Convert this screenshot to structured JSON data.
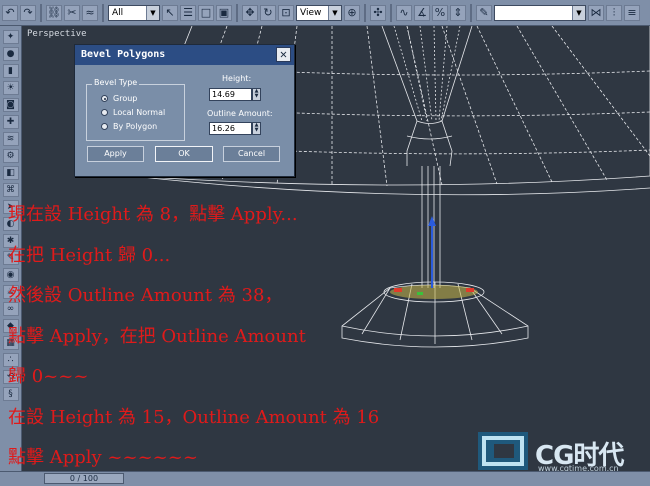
{
  "toolbar": {
    "selection_filter": "All",
    "reference_coord": "View",
    "named_selection": ""
  },
  "viewport": {
    "label": "Perspective"
  },
  "dialog": {
    "title": "Bevel Polygons",
    "close_glyph": "✕",
    "bevel_type": {
      "title": "Bevel Type",
      "options": [
        "Group",
        "Local Normal",
        "By Polygon"
      ],
      "selected": "Group"
    },
    "height": {
      "label": "Height:",
      "value": "14.69"
    },
    "outline_amount": {
      "label": "Outline Amount:",
      "value": "16.26"
    },
    "buttons": {
      "apply": "Apply",
      "ok": "OK",
      "cancel": "Cancel"
    }
  },
  "instructions": [
    "現在設 Height 為 8，點擊 Apply...",
    "在把 Height 歸 0...",
    "然後設 Outline Amount 為 38，",
    "點擊 Apply，在把 Outline Amount",
    "歸 0~~~",
    "在設 Height 為 15，Outline Amount 為 16",
    "點擊 Apply ~~~~~~"
  ],
  "timeline": {
    "frame": "0 / 100"
  },
  "watermark": {
    "brand": "CG时代",
    "url": "www.cgtime.com.cn"
  },
  "colors": {
    "overlay_text": "#e01a1a",
    "title_bar": "#2c4d84",
    "panel": "#7a8ea8",
    "viewport": "#2f3742"
  }
}
